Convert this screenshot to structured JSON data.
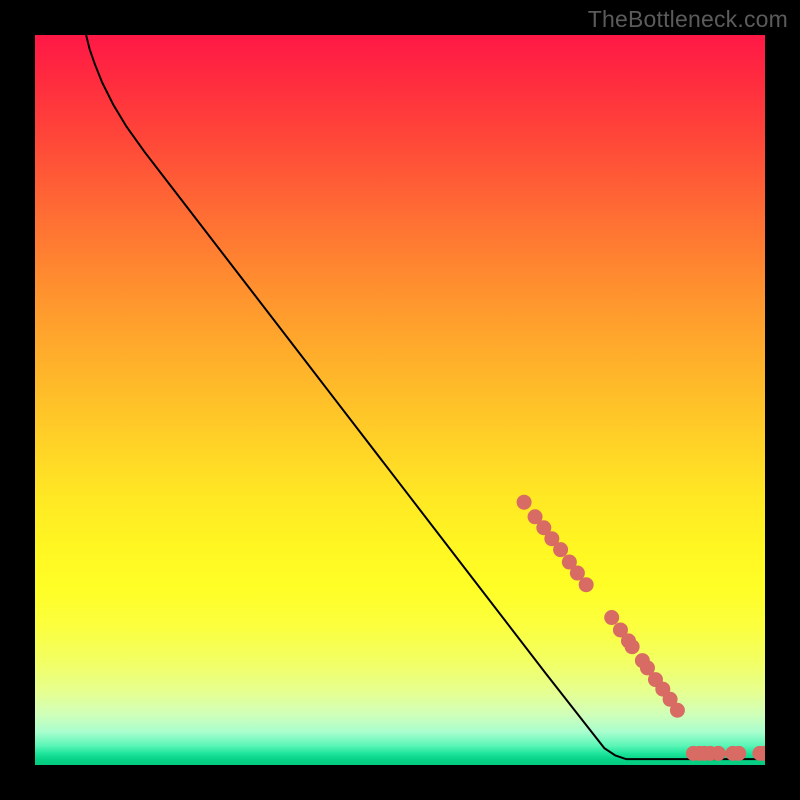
{
  "watermark": "TheBottleneck.com",
  "colors": {
    "curve_stroke": "#000000",
    "marker_fill": "#d86b63",
    "marker_stroke": "#d86b63"
  },
  "chart_data": {
    "type": "line",
    "title": "",
    "xlabel": "",
    "ylabel": "",
    "xlim": [
      0,
      100
    ],
    "ylim": [
      0,
      100
    ],
    "grid": false,
    "curve_points": [
      {
        "x": 7,
        "y": 100
      },
      {
        "x": 7.5,
        "y": 98
      },
      {
        "x": 8.2,
        "y": 96
      },
      {
        "x": 9.2,
        "y": 93.5
      },
      {
        "x": 10.7,
        "y": 90.5
      },
      {
        "x": 12.5,
        "y": 87.5
      },
      {
        "x": 15,
        "y": 84
      },
      {
        "x": 20,
        "y": 77.5
      },
      {
        "x": 30,
        "y": 64.5
      },
      {
        "x": 40,
        "y": 51.5
      },
      {
        "x": 50,
        "y": 38.5
      },
      {
        "x": 60,
        "y": 25.5
      },
      {
        "x": 70,
        "y": 12.5
      },
      {
        "x": 78,
        "y": 2.3
      },
      {
        "x": 79.5,
        "y": 1.3
      },
      {
        "x": 81,
        "y": 0.8
      },
      {
        "x": 85,
        "y": 0.8
      },
      {
        "x": 90,
        "y": 0.8
      },
      {
        "x": 95,
        "y": 0.8
      },
      {
        "x": 100,
        "y": 0.8
      }
    ],
    "markers": [
      {
        "x": 67.0,
        "y": 36.0
      },
      {
        "x": 68.5,
        "y": 34.0
      },
      {
        "x": 69.7,
        "y": 32.5
      },
      {
        "x": 70.8,
        "y": 31.0
      },
      {
        "x": 72.0,
        "y": 29.5
      },
      {
        "x": 73.2,
        "y": 27.8
      },
      {
        "x": 74.3,
        "y": 26.3
      },
      {
        "x": 75.5,
        "y": 24.7
      },
      {
        "x": 79.0,
        "y": 20.2
      },
      {
        "x": 80.2,
        "y": 18.5
      },
      {
        "x": 81.3,
        "y": 17.0
      },
      {
        "x": 81.8,
        "y": 16.2
      },
      {
        "x": 83.2,
        "y": 14.3
      },
      {
        "x": 83.9,
        "y": 13.3
      },
      {
        "x": 85.0,
        "y": 11.7
      },
      {
        "x": 86.0,
        "y": 10.4
      },
      {
        "x": 87.0,
        "y": 9.0
      },
      {
        "x": 88.0,
        "y": 7.5
      },
      {
        "x": 90.2,
        "y": 1.6
      },
      {
        "x": 91.0,
        "y": 1.6
      },
      {
        "x": 91.7,
        "y": 1.6
      },
      {
        "x": 92.5,
        "y": 1.6
      },
      {
        "x": 93.6,
        "y": 1.6
      },
      {
        "x": 95.6,
        "y": 1.6
      },
      {
        "x": 96.4,
        "y": 1.6
      },
      {
        "x": 99.3,
        "y": 1.6
      },
      {
        "x": 99.9,
        "y": 1.6
      }
    ]
  }
}
